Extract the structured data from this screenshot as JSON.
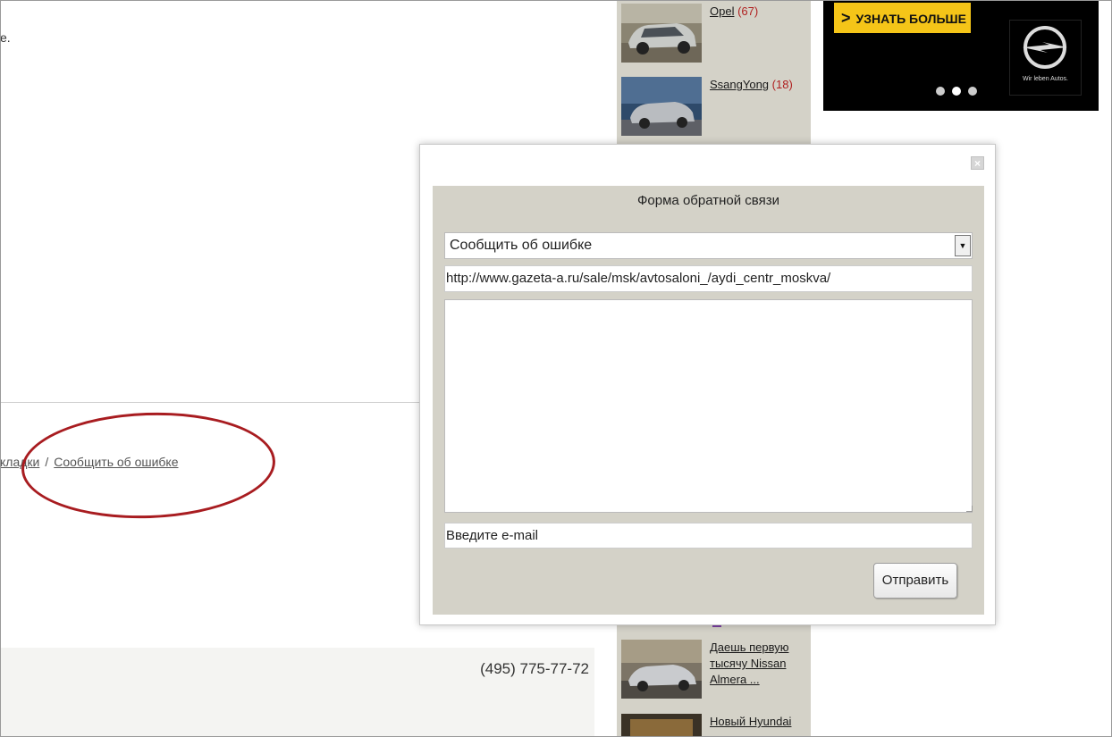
{
  "page": {
    "top_fragment": "e.",
    "bottom_links": {
      "bookmarks_fragment": "кладки",
      "separator": "/",
      "report_error": "Сообщить об ошибке"
    },
    "footer_phone": "(495) 775-77-72"
  },
  "cars": [
    {
      "name": "Opel",
      "count": "(67)"
    },
    {
      "name": "SsangYong",
      "count": "(18)"
    },
    {
      "name": "Даешь первую тысячу Nissan Almera ...",
      "count": ""
    },
    {
      "name": "Новый Hyundai",
      "count": ""
    }
  ],
  "ad": {
    "button_label": "УЗНАТЬ БОЛЬШЕ",
    "logo_tagline": "Wir leben Autos."
  },
  "modal": {
    "close_glyph": "×",
    "title": "Форма обратной связи",
    "select_value": "Сообщить об ошибке",
    "select_arrow": "▼",
    "url_value": "http://www.gazeta-a.ru/sale/msk/avtosaloni_/aydi_centr_moskva/",
    "message_value": "",
    "email_value": "Введите e-mail",
    "submit_label": "Отправить"
  },
  "colors": {
    "panel_bg": "#d4d2c8",
    "highlight_ellipse": "#a81c20",
    "ad_button": "#f5c518",
    "count_red": "#b02020"
  }
}
